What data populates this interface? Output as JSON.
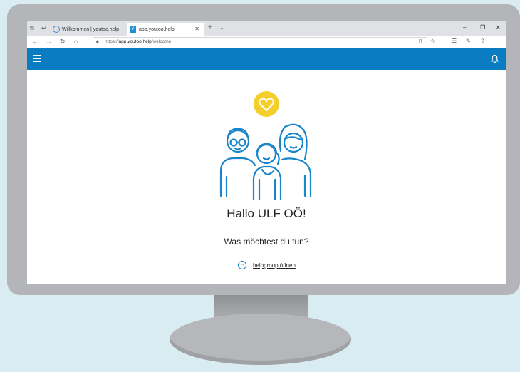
{
  "browser": {
    "tabs": [
      {
        "label": "Willkommen | youtoo.help",
        "active": false
      },
      {
        "label": "app.youtoo.help",
        "active": true
      }
    ],
    "url_prefix": "https://",
    "url_host": "app.youtoo.help",
    "url_path": "/welcome"
  },
  "icons": {
    "menu": "hamburger-icon",
    "notifications": "bell-icon",
    "illustration": "three-people-with-heart",
    "action": "arrow-circle-right-icon"
  },
  "colors": {
    "appbar": "#0a7dc2",
    "accent": "#1a86c9",
    "heart": "#f4cf2b"
  },
  "main": {
    "greeting": "Hallo ULF OÖ!",
    "question": "Was möchtest du tun?",
    "action_label": "helpgroup öffnen"
  }
}
